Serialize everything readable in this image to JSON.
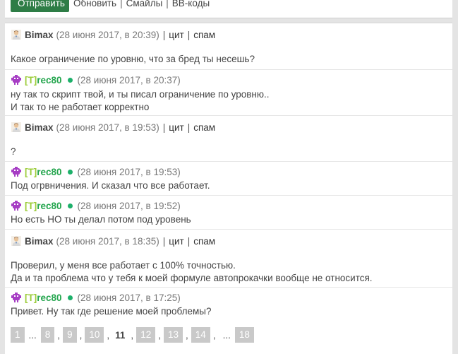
{
  "toolbar": {
    "send": "Отправить",
    "refresh": "Обновить",
    "smiles": "Смайлы",
    "bbcodes": "BB-коды"
  },
  "messages": [
    {
      "author": "Bimax",
      "author_type": "user",
      "date": "(28 июня 2017, в 20:39)",
      "quote": "цит",
      "spam": "спам",
      "lines": [
        "Какое ограничение по уровню, что за бред ты несешь?"
      ]
    },
    {
      "author_open": "[T]",
      "author_rest": "rec80",
      "author_type": "moderator",
      "date": "(28 июня 2017, в 20:37)",
      "lines": [
        "ну так то скрипт твой, и ты писал ограничение по уровню..",
        "И так то не работает корректно"
      ]
    },
    {
      "author": "Bimax",
      "author_type": "user",
      "date": "(28 июня 2017, в 19:53)",
      "quote": "цит",
      "spam": "спам",
      "lines": [
        "?"
      ]
    },
    {
      "author_open": "[T]",
      "author_rest": "rec80",
      "author_type": "moderator",
      "date": "(28 июня 2017, в 19:53)",
      "lines": [
        "Под огрвничения. И сказал что все работает."
      ]
    },
    {
      "author_open": "[T]",
      "author_rest": "rec80",
      "author_type": "moderator",
      "date": "(28 июня 2017, в 19:52)",
      "lines": [
        "Но есть НО ты делал потом под уровень"
      ]
    },
    {
      "author": "Bimax",
      "author_type": "user",
      "date": "(28 июня 2017, в 18:35)",
      "quote": "цит",
      "spam": "спам",
      "lines": [
        "Проверил, у меня все работает с 100% точностью.",
        "Да и та проблема что у тебя к моей формуле автопрокачки вообще не относится."
      ]
    },
    {
      "author_open": "[T]",
      "author_rest": "rec80",
      "author_type": "moderator",
      "date": "(28 июня 2017, в 17:25)",
      "lines": [
        "Привет. Ну так где решение моей проблемы?"
      ]
    }
  ],
  "pagination": {
    "first": "1",
    "ellipsis": "...",
    "p8": "8",
    "p9": "9",
    "p10": "10",
    "current": "11",
    "p12": "12",
    "p13": "13",
    "p14": "14",
    "last": "18",
    "separator": ","
  },
  "colors": {
    "send_button": "#2e7d46",
    "moderator_name": "#23a54d",
    "online_dot": "#1db06a",
    "page_box": "#c9c9c9"
  }
}
